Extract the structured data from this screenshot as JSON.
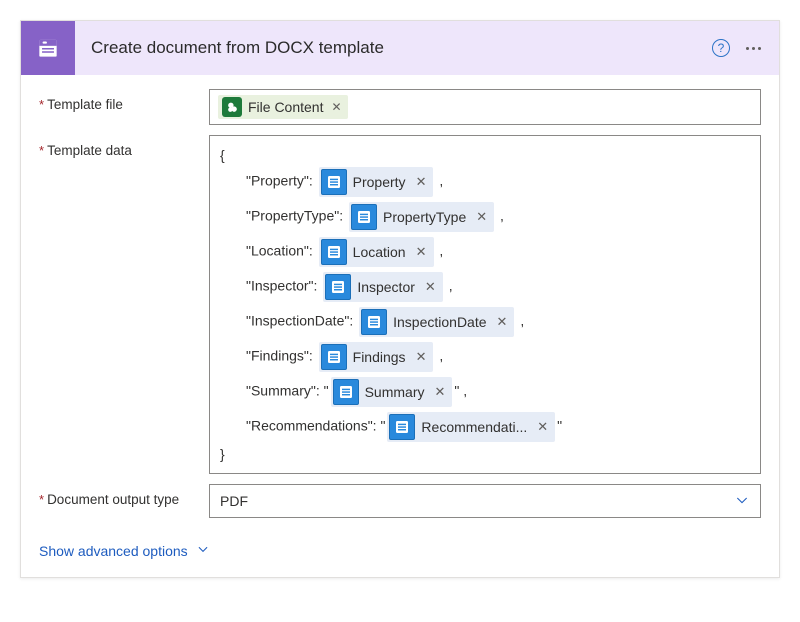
{
  "header": {
    "title": "Create document from DOCX template"
  },
  "labels": {
    "template_file": "Template file",
    "template_data": "Template data",
    "document_output": "Document output type"
  },
  "file_token": {
    "name": "File Content"
  },
  "template_json": {
    "properties": [
      {
        "key": "Property",
        "token": "Property",
        "quoted": false
      },
      {
        "key": "PropertyType",
        "token": "PropertyType",
        "quoted": false
      },
      {
        "key": "Location",
        "token": "Location",
        "quoted": false
      },
      {
        "key": "Inspector",
        "token": "Inspector",
        "quoted": false
      },
      {
        "key": "InspectionDate",
        "token": "InspectionDate",
        "quoted": false
      },
      {
        "key": "Findings",
        "token": "Findings",
        "quoted": false
      },
      {
        "key": "Summary",
        "token": "Summary",
        "quoted": true
      },
      {
        "key": "Recommendations",
        "token": "Recommendati...",
        "quoted": true
      }
    ]
  },
  "output": {
    "value": "PDF"
  },
  "advanced": {
    "label": "Show advanced options"
  }
}
